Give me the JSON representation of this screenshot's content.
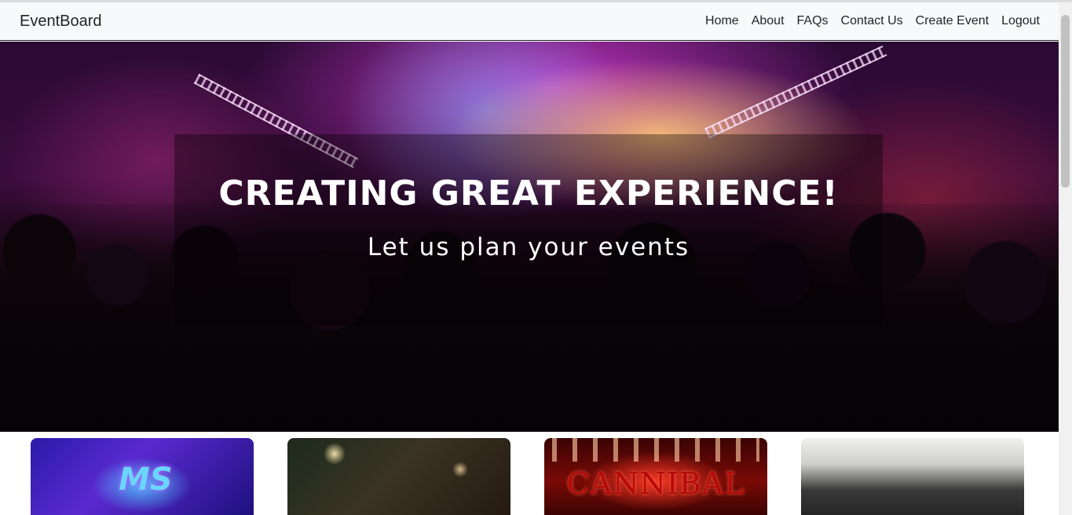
{
  "navbar": {
    "brand": "EventBoard",
    "links": [
      {
        "label": "Home"
      },
      {
        "label": "About"
      },
      {
        "label": "FAQs"
      },
      {
        "label": "Contact Us"
      },
      {
        "label": "Create Event"
      },
      {
        "label": "Logout"
      }
    ]
  },
  "hero": {
    "title": "CREATING GREAT EXPERIENCE!",
    "subtitle": "Let us plan your events"
  },
  "cards": [
    {
      "logo_text": "MS",
      "icon": "event-poster-image"
    },
    {
      "icon": "dinner-party-image"
    },
    {
      "logo_text": "CANNIBAL",
      "icon": "concert-poster-image"
    },
    {
      "icon": "group-photo-image"
    }
  ]
}
